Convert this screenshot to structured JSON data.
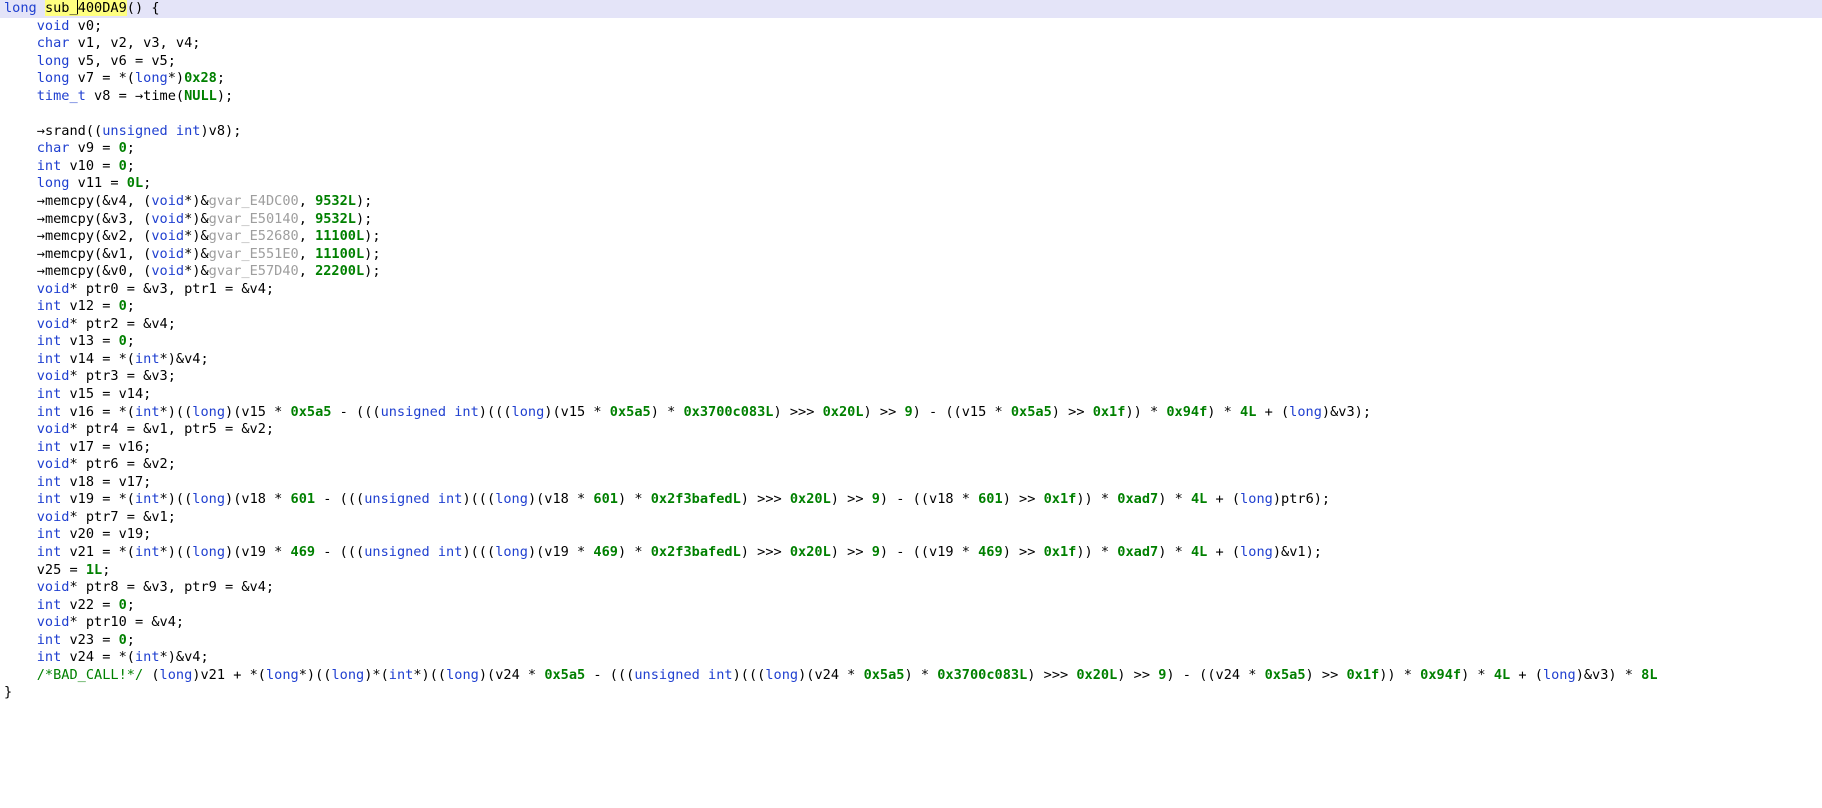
{
  "view": {
    "name": "decompiler-pseudocode",
    "highlight_line_color": "#e4e4f8",
    "name_highlight_color": "#ffff80",
    "keyword_color": "#2040d0",
    "constant_color": "#008000",
    "global_color": "#9e9e9e",
    "comment_color": "#008000",
    "background_color": "#ffffff",
    "text_color": "#000000"
  },
  "function": {
    "return_type": "long",
    "name": "sub_400DA9",
    "signature_suffix": "() {",
    "closing_brace": "}"
  },
  "lines": [
    {
      "n": 0,
      "indent": 0,
      "text": "long sub_400DA9() {"
    },
    {
      "n": 1,
      "indent": 1,
      "text": "void v0;"
    },
    {
      "n": 2,
      "indent": 1,
      "text": "char v1, v2, v3, v4;"
    },
    {
      "n": 3,
      "indent": 1,
      "text": "long v5, v6 = v5;"
    },
    {
      "n": 4,
      "indent": 1,
      "text": "long v7 = *(long*)0x28;"
    },
    {
      "n": 5,
      "indent": 1,
      "text": "time_t v8 = →time(NULL);"
    },
    {
      "n": 6,
      "indent": 1,
      "text": ""
    },
    {
      "n": 7,
      "indent": 1,
      "text": "→srand((unsigned int)v8);"
    },
    {
      "n": 8,
      "indent": 1,
      "text": "char v9 = 0;"
    },
    {
      "n": 9,
      "indent": 1,
      "text": "int v10 = 0;"
    },
    {
      "n": 10,
      "indent": 1,
      "text": "long v11 = 0L;"
    },
    {
      "n": 11,
      "indent": 1,
      "text": "→memcpy(&v4, (void*)&gvar_E4DC00, 9532L);"
    },
    {
      "n": 12,
      "indent": 1,
      "text": "→memcpy(&v3, (void*)&gvar_E50140, 9532L);"
    },
    {
      "n": 13,
      "indent": 1,
      "text": "→memcpy(&v2, (void*)&gvar_E52680, 11100L);"
    },
    {
      "n": 14,
      "indent": 1,
      "text": "→memcpy(&v1, (void*)&gvar_E551E0, 11100L);"
    },
    {
      "n": 15,
      "indent": 1,
      "text": "→memcpy(&v0, (void*)&gvar_E57D40, 22200L);"
    },
    {
      "n": 16,
      "indent": 1,
      "text": "void* ptr0 = &v3, ptr1 = &v4;"
    },
    {
      "n": 17,
      "indent": 1,
      "text": "int v12 = 0;"
    },
    {
      "n": 18,
      "indent": 1,
      "text": "void* ptr2 = &v4;"
    },
    {
      "n": 19,
      "indent": 1,
      "text": "int v13 = 0;"
    },
    {
      "n": 20,
      "indent": 1,
      "text": "int v14 = *(int*)&v4;"
    },
    {
      "n": 21,
      "indent": 1,
      "text": "void* ptr3 = &v3;"
    },
    {
      "n": 22,
      "indent": 1,
      "text": "int v15 = v14;"
    },
    {
      "n": 23,
      "indent": 1,
      "text": "int v16 = *(int*)((long)(v15 * 0x5a5 - (((unsigned int)(((long)(v15 * 0x5a5) * 0x3700c083L) >>> 0x20L) >> 9) - ((v15 * 0x5a5) >> 0x1f)) * 0x94f) * 4L + (long)&v3);"
    },
    {
      "n": 24,
      "indent": 1,
      "text": "void* ptr4 = &v1, ptr5 = &v2;"
    },
    {
      "n": 25,
      "indent": 1,
      "text": "int v17 = v16;"
    },
    {
      "n": 26,
      "indent": 1,
      "text": "void* ptr6 = &v2;"
    },
    {
      "n": 27,
      "indent": 1,
      "text": "int v18 = v17;"
    },
    {
      "n": 28,
      "indent": 1,
      "text": "int v19 = *(int*)((long)(v18 * 601 - (((unsigned int)(((long)(v18 * 601) * 0x2f3bafedL) >>> 0x20L) >> 9) - ((v18 * 601) >> 0x1f)) * 0xad7) * 4L + (long)ptr6);"
    },
    {
      "n": 29,
      "indent": 1,
      "text": "void* ptr7 = &v1;"
    },
    {
      "n": 30,
      "indent": 1,
      "text": "int v20 = v19;"
    },
    {
      "n": 31,
      "indent": 1,
      "text": "int v21 = *(int*)((long)(v19 * 469 - (((unsigned int)(((long)(v19 * 469) * 0x2f3bafedL) >>> 0x20L) >> 9) - ((v19 * 469) >> 0x1f)) * 0xad7) * 4L + (long)&v1);"
    },
    {
      "n": 32,
      "indent": 1,
      "text": "v25 = 1L;"
    },
    {
      "n": 33,
      "indent": 1,
      "text": "void* ptr8 = &v3, ptr9 = &v4;"
    },
    {
      "n": 34,
      "indent": 1,
      "text": "int v22 = 0;"
    },
    {
      "n": 35,
      "indent": 1,
      "text": "void* ptr10 = &v4;"
    },
    {
      "n": 36,
      "indent": 1,
      "text": "int v23 = 0;"
    },
    {
      "n": 37,
      "indent": 1,
      "text": "int v24 = *(int*)&v4;"
    },
    {
      "n": 38,
      "indent": 1,
      "text": "/*BAD_CALL!*/ (long)v21 + *(long*)((long)*(int*)((long)(v24 * 0x5a5 - (((unsigned int)(((long)(v24 * 0x5a5) * 0x3700c083L) >>> 0x20L) >> 9) - ((v24 * 0x5a5) >> 0x1f)) * 0x94f) * 4L + (long)&v3) * 8L"
    },
    {
      "n": 39,
      "indent": 0,
      "text": "}"
    }
  ],
  "symbols": {
    "globals": [
      "gvar_E4DC00",
      "gvar_E50140",
      "gvar_E52680",
      "gvar_E551E0",
      "gvar_E57D40"
    ],
    "calls": [
      "time",
      "srand",
      "memcpy"
    ],
    "comment": "/*BAD_CALL!*/",
    "variables": [
      "v0",
      "v1",
      "v2",
      "v3",
      "v4",
      "v5",
      "v6",
      "v7",
      "v8",
      "v9",
      "v10",
      "v11",
      "v12",
      "v13",
      "v14",
      "v15",
      "v16",
      "v17",
      "v18",
      "v19",
      "v20",
      "v21",
      "v22",
      "v23",
      "v24",
      "v25",
      "ptr0",
      "ptr1",
      "ptr2",
      "ptr3",
      "ptr4",
      "ptr5",
      "ptr6",
      "ptr7",
      "ptr8",
      "ptr9",
      "ptr10"
    ]
  }
}
